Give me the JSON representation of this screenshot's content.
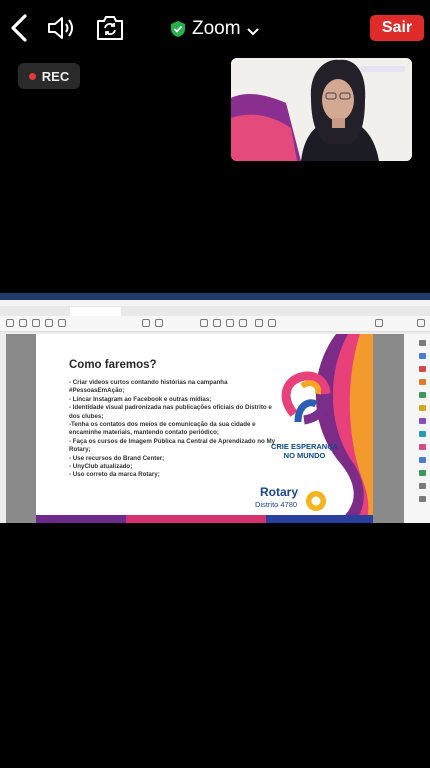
{
  "top_bar": {
    "meeting_name": "Zoom",
    "leave_label": "Sair"
  },
  "recording": {
    "label": "REC"
  },
  "colors": {
    "leave": "#e02b2b",
    "secure": "#23b24b",
    "record_dot": "#e53a3a"
  },
  "shared_screen": {
    "slide": {
      "heading": "Como faremos?",
      "bullets": [
        "- Criar videos curtos contando histórias na campanha #PessoasEmAção;",
        "- Lincar Instagram ao Facebook e outras mídias;",
        "- Identidade visual padronizada nas publicações oficiais do Distrito e dos clubes;",
        "-Tenha os contatos dos meios de comunicação da sua cidade e encaminhe materiais, mantendo contato periódico;",
        "- Faça os cursos de Imagem Pública na Central de Aprendizado no My Rotary;",
        "- Use recursos do Brand Center;",
        "- UnyClub atualizado;",
        "- Uso correto da marca Rotary;"
      ],
      "campaign_line1": "CRIE ESPERANÇA",
      "campaign_line2": "NO MUNDO",
      "brand": "Rotary",
      "district": "Distrito 4780"
    }
  }
}
